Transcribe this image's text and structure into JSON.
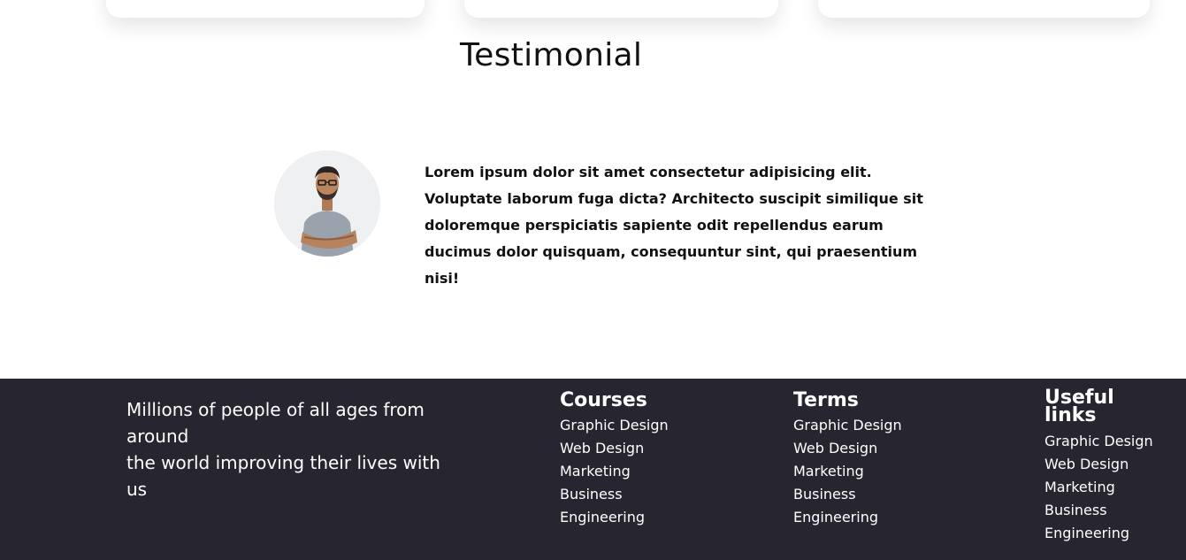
{
  "testimonial": {
    "title": "Testimonial",
    "quote": "Lorem ipsum dolor sit amet consectetur adipisicing elit. Voluptate laborum fuga dicta? Architecto suscipit similique sit doloremque perspiciatis sapiente odit repellendus earum ducimus dolor quisquam, consequuntur sint, qui praesentium nisi!"
  },
  "footer": {
    "tagline_line1": "Millions of people of all ages from around",
    "tagline_line2": "the world improving their lives with us",
    "columns": [
      {
        "title": "Courses",
        "links": [
          "Graphic Design",
          "Web Design",
          "Marketing",
          "Business",
          "Engineering"
        ]
      },
      {
        "title": "Terms",
        "links": [
          "Graphic Design",
          "Web Design",
          "Marketing",
          "Business",
          "Engineering"
        ]
      },
      {
        "title": "Useful links",
        "links": [
          "Graphic Design",
          "Web Design",
          "Marketing",
          "Business",
          "Engineering"
        ]
      }
    ]
  }
}
